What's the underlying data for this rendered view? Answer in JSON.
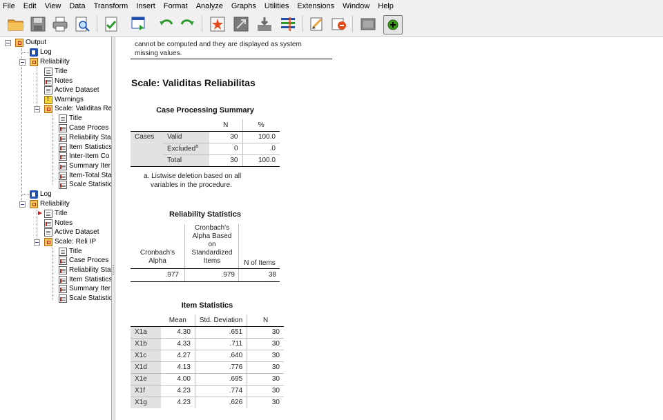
{
  "menu": [
    "File",
    "Edit",
    "View",
    "Data",
    "Transform",
    "Insert",
    "Format",
    "Analyze",
    "Graphs",
    "Utilities",
    "Extensions",
    "Window",
    "Help"
  ],
  "toolbar_icons": [
    "open-folder-icon",
    "save-icon",
    "print-icon",
    "print-preview-icon",
    "export-icon",
    "recall-dialog-icon",
    "undo-icon",
    "redo-icon",
    "goto-data-icon",
    "goto-variable-icon",
    "insert-case-icon",
    "variables-icon",
    "select-last-output-icon",
    "designate-window-icon",
    "hide-icon",
    "insert-output-icon"
  ],
  "tree": {
    "output": "Output",
    "log1": "Log",
    "reliability1": "Reliability",
    "r1_title": "Title",
    "r1_notes": "Notes",
    "r1_active": "Active Dataset",
    "r1_warnings": "Warnings",
    "r1_scale": "Scale: Validitas Re",
    "r1_s_title": "Title",
    "r1_s_case": "Case Proces",
    "r1_s_rel": "Reliability Sta",
    "r1_s_item": "Item Statistics",
    "r1_s_inter": "Inter-Item Co",
    "r1_s_summary": "Summary Iter",
    "r1_s_itemtotal": "Item-Total Sta",
    "r1_s_scale": "Scale Statistic",
    "log2": "Log",
    "reliability2": "Reliability",
    "r2_title": "Title",
    "r2_notes": "Notes",
    "r2_active": "Active Dataset",
    "r2_scale": "Scale: Reli IP",
    "r2_s_title": "Title",
    "r2_s_case": "Case Proces",
    "r2_s_rel": "Reliability Sta",
    "r2_s_item": "Item Statistics",
    "r2_s_summary": "Summary Iter",
    "r2_s_scale": "Scale Statistic"
  },
  "output": {
    "prev_note_line1": "cannot be computed and they are displayed as system",
    "prev_note_line2": "missing values.",
    "scale_title": "Scale: Validitas Reliabilitas",
    "case_processing": {
      "title": "Case Processing Summary",
      "col_n": "N",
      "col_pct": "%",
      "group": "Cases",
      "rows": [
        {
          "label": "Valid",
          "n": "30",
          "pct": "100.0"
        },
        {
          "label": "Excluded",
          "sup": "a",
          "n": "0",
          "pct": ".0"
        },
        {
          "label": "Total",
          "n": "30",
          "pct": "100.0"
        }
      ],
      "footnote_line1": "a. Listwise deletion based on all",
      "footnote_line2": "variables in the procedure."
    },
    "reliability": {
      "title": "Reliability Statistics",
      "h1_line1": "Cronbach's",
      "h1_line2": "Alpha",
      "h2_line1": "Cronbach's",
      "h2_line2": "Alpha Based",
      "h2_line3": "on",
      "h2_line4": "Standardized",
      "h2_line5": "Items",
      "h3": "N of Items",
      "alpha": ".977",
      "alpha_std": ".979",
      "n_items": "38"
    },
    "item_stats": {
      "title": "Item Statistics",
      "col_mean": "Mean",
      "col_sd": "Std. Deviation",
      "col_n": "N",
      "rows": [
        {
          "item": "X1a",
          "mean": "4.30",
          "sd": ".651",
          "n": "30"
        },
        {
          "item": "X1b",
          "mean": "4.33",
          "sd": ".711",
          "n": "30"
        },
        {
          "item": "X1c",
          "mean": "4.27",
          "sd": ".640",
          "n": "30"
        },
        {
          "item": "X1d",
          "mean": "4.13",
          "sd": ".776",
          "n": "30"
        },
        {
          "item": "X1e",
          "mean": "4.00",
          "sd": ".695",
          "n": "30"
        },
        {
          "item": "X1f",
          "mean": "4.23",
          "sd": ".774",
          "n": "30"
        },
        {
          "item": "X1g",
          "mean": "4.23",
          "sd": ".626",
          "n": "30"
        }
      ]
    }
  }
}
